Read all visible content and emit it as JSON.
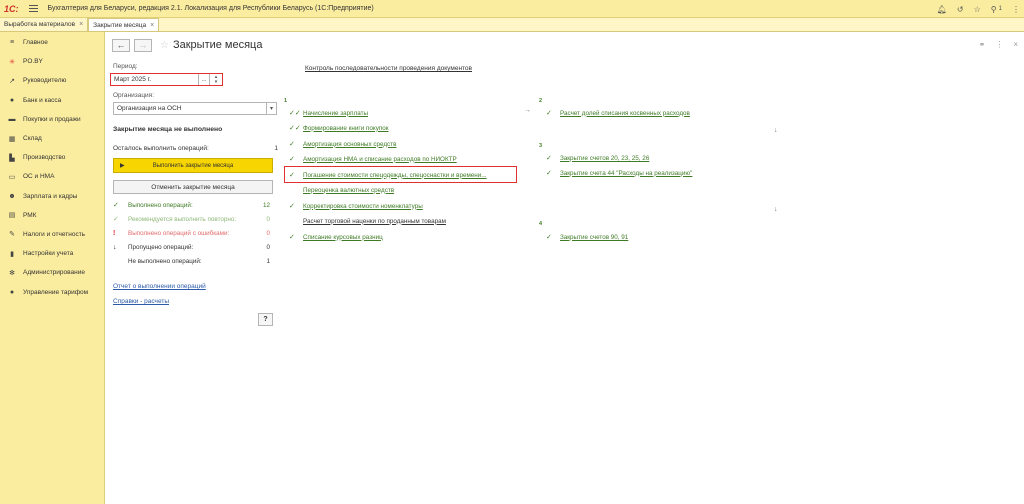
{
  "titlebar": {
    "logo": "1С:",
    "app_title": "Бухгалтерия для Беларуси, редакция 2.1. Локализация для Республики Беларусь  (1С:Предприятие)",
    "notification_count": "1"
  },
  "tabs": [
    {
      "label": "Выработка материалов",
      "close": "×"
    },
    {
      "label": "Закрытие месяца",
      "close": "×"
    }
  ],
  "sidebar": {
    "items": [
      {
        "label": "Главное",
        "icon": "≡"
      },
      {
        "label": "PO.BY",
        "icon": "✳"
      },
      {
        "label": "Руководителю",
        "icon": "↗"
      },
      {
        "label": "Банк и касса",
        "icon": "●"
      },
      {
        "label": "Покупки и продажи",
        "icon": "▬"
      },
      {
        "label": "Склад",
        "icon": "▦"
      },
      {
        "label": "Производство",
        "icon": "▙"
      },
      {
        "label": "ОС и НМА",
        "icon": "▭"
      },
      {
        "label": "Зарплата и кадры",
        "icon": "☻"
      },
      {
        "label": "РМК",
        "icon": "▤"
      },
      {
        "label": "Налоги и отчетность",
        "icon": "✎"
      },
      {
        "label": "Настройки учета",
        "icon": "▮"
      },
      {
        "label": "Администрирование",
        "icon": "✻"
      },
      {
        "label": "Управление тарифом",
        "icon": "●"
      }
    ]
  },
  "page": {
    "title": "Закрытие месяца",
    "back": "←",
    "forward": "→",
    "star": "☆",
    "link_icon": "🔗",
    "more_icon": "⋮",
    "close_icon": "×"
  },
  "form": {
    "period_label": "Период:",
    "period_value": "Март 2025 г.",
    "period_select": "...",
    "org_label": "Организация:",
    "org_value": "Организация на ОСН",
    "status_title": "Закрытие месяца не выполнено",
    "remain_label": "Осталось выполнить операций:",
    "remain_count": "1",
    "run_button": "Выполнить закрытие месяца",
    "cancel_button": "Отменить закрытие месяца",
    "stats": [
      {
        "icon": "✓",
        "label": "Выполнено операций:",
        "count": "12",
        "color": "#3f7b25"
      },
      {
        "icon": "✓",
        "label": "Рекомендуется выполнить повторно:",
        "count": "0",
        "color": "#8fb87a"
      },
      {
        "icon": "!",
        "label": "Выполнено операций с ошибками:",
        "count": "0",
        "color": "#e06a6a"
      },
      {
        "icon": "↓",
        "label": "Пропущено операций:",
        "count": "0",
        "color": "#333333"
      },
      {
        "icon": "",
        "label": "Не выполнено операций:",
        "count": "1",
        "color": "#333333"
      }
    ],
    "report_link": "Отчет о выполнении операций",
    "help_link": "Справки - расчеты",
    "help_button": "?"
  },
  "operations": {
    "control_link": "Контроль последовательности проведения документов",
    "steps": {
      "s1": "1",
      "s2": "2",
      "s3": "3",
      "s4": "4"
    },
    "col1": [
      {
        "icon": "✓✓",
        "label": "Начисление зарплаты",
        "done": true
      },
      {
        "icon": "✓✓",
        "label": "Формирование книги покупок",
        "done": true
      },
      {
        "icon": "✓",
        "label": "Амортизация основных средств",
        "done": true
      },
      {
        "icon": "✓",
        "label": "Амортизация НМА и списание расходов по НИОКТР",
        "done": true
      },
      {
        "icon": "✓",
        "label": "Погашение стоимости спецодежды, спецоснастки и времени...",
        "done": true
      },
      {
        "icon": "",
        "label": "Переоценка валютных средств",
        "done": true
      },
      {
        "icon": "✓",
        "label": "Корректировка стоимости номенклатуры",
        "done": true
      },
      {
        "icon": "",
        "label": "Расчет торговой наценки по проданным товарам",
        "done": false
      },
      {
        "icon": "✓",
        "label": "Списание курсовых разниц",
        "done": true
      }
    ],
    "col2": [
      {
        "icon": "✓",
        "label": "Расчет долей списания косвенных расходов"
      },
      {
        "icon": "✓",
        "label": "Закрытие счетов 20, 23, 25, 26"
      },
      {
        "icon": "✓",
        "label": "Закрытие счета 44 \"Расходы на реализацию\""
      },
      {
        "icon": "✓",
        "label": "Закрытие счетов 90, 91"
      }
    ],
    "arrow_right": "→",
    "arrow_down": "↓"
  }
}
